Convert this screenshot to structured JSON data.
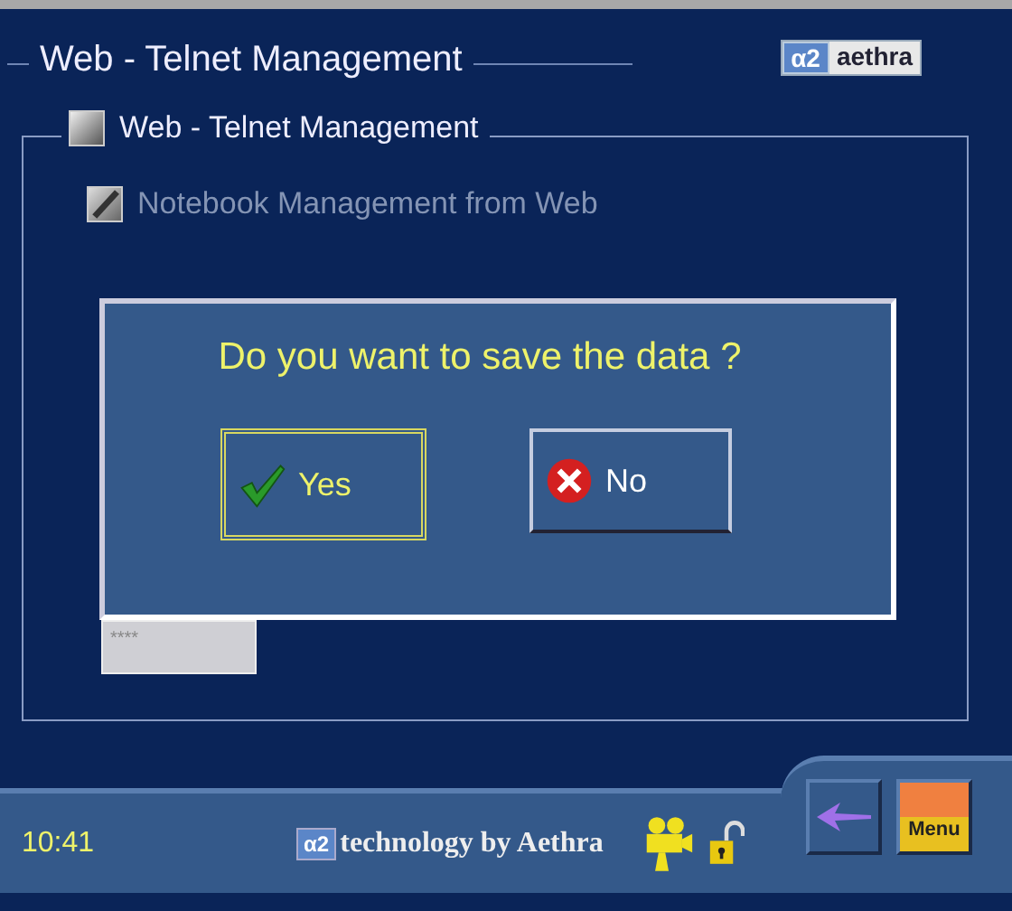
{
  "header": {
    "title": "Web - Telnet Management",
    "logo": {
      "mark": "α2",
      "name": "aethra"
    }
  },
  "group": {
    "label": "Web - Telnet Management",
    "checked": false,
    "options": [
      {
        "label": "Notebook Management from Web",
        "checked": true,
        "disabled": true
      }
    ],
    "password": {
      "value": "****"
    }
  },
  "dialog": {
    "question": "Do you want to save the data ?",
    "buttons": [
      {
        "label": "Yes",
        "kind": "yes",
        "selected": true
      },
      {
        "label": "No",
        "kind": "no",
        "selected": false
      }
    ]
  },
  "status_bar": {
    "time": "10:41",
    "brand_mark": "α2",
    "brand_text": "technology by Aethra",
    "menu_label": "Menu"
  }
}
